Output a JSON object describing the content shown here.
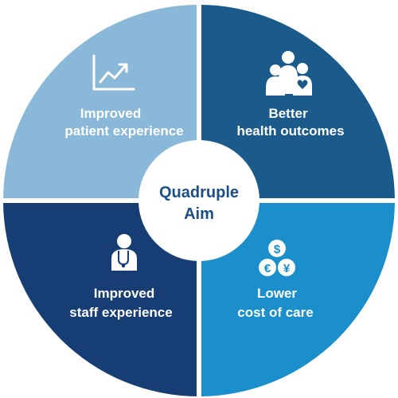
{
  "center": {
    "line1": "Quadruple",
    "line2": "Aim"
  },
  "quadrants": {
    "top_left": {
      "line1": "Improved",
      "line2": "patient experience",
      "icon": "trend-chart-icon",
      "color": "#8ab8d8"
    },
    "top_right": {
      "line1": "Better",
      "line2": "health outcomes",
      "icon": "family-heart-icon",
      "color": "#1b5b8c"
    },
    "bottom_left": {
      "line1": "Improved",
      "line2": "staff experience",
      "icon": "doctor-stethoscope-icon",
      "color": "#163e74"
    },
    "bottom_right": {
      "line1": "Lower",
      "line2": "cost of care",
      "icon": "currency-coins-icon",
      "color": "#1a8fcb"
    }
  },
  "coin_symbols": {
    "dollar": "$",
    "euro": "€",
    "yen": "¥"
  },
  "colors": {
    "center_fill": "#ffffff",
    "center_text": "#1c4f87",
    "divider": "#ffffff"
  }
}
